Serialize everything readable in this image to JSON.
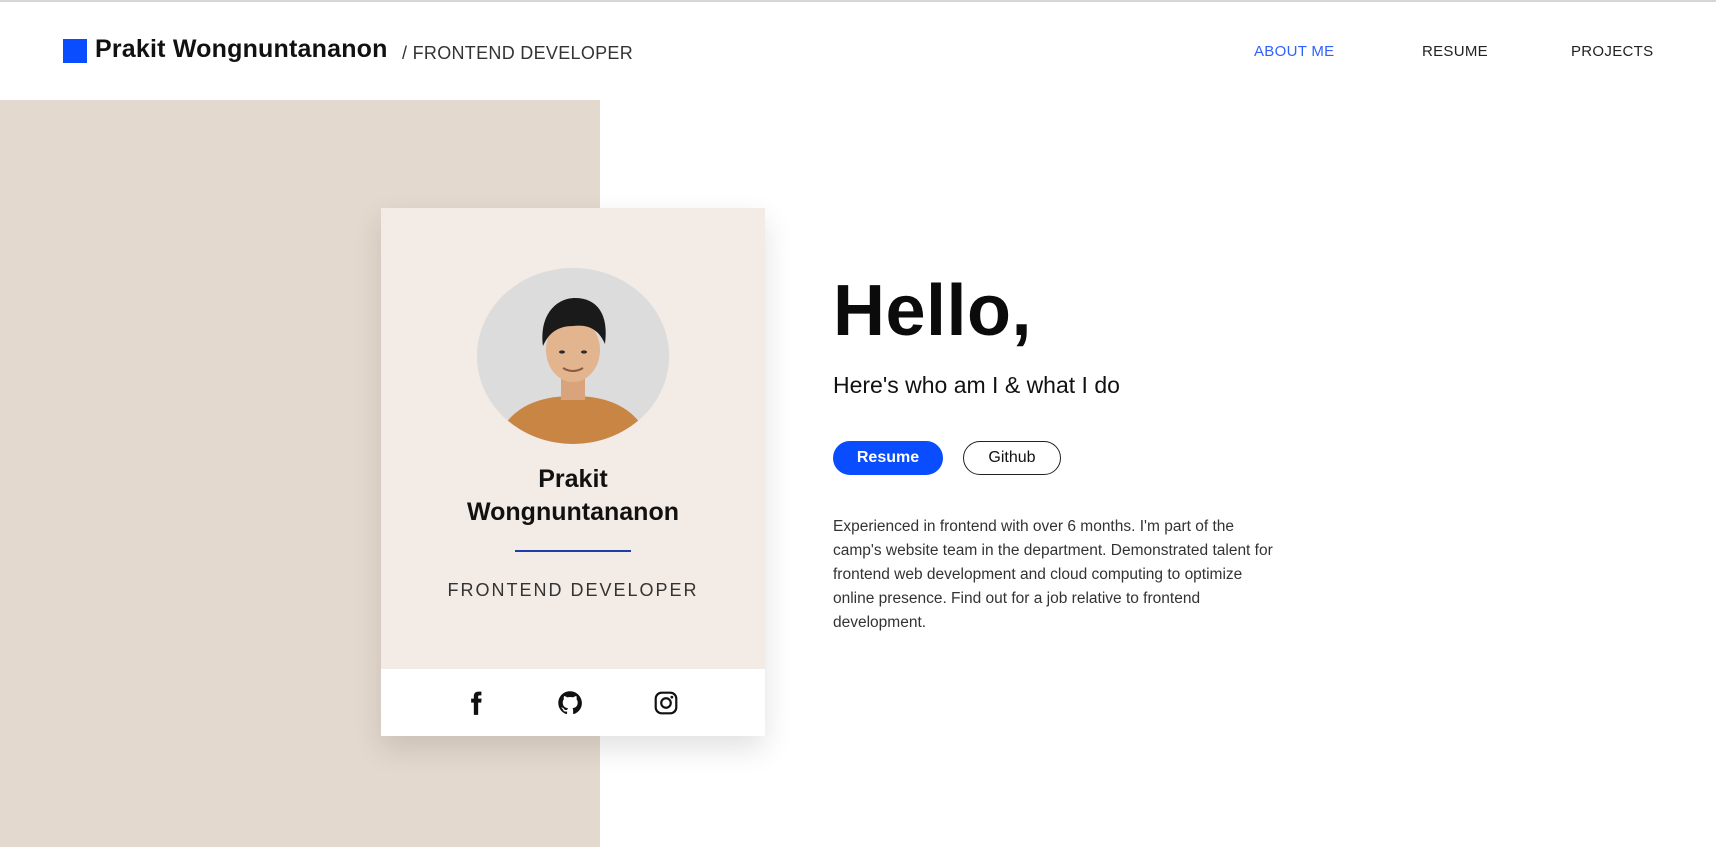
{
  "header": {
    "name": "Prakit Wongnuntananon",
    "role": "/ FRONTEND DEVELOPER",
    "nav": [
      {
        "label": "ABOUT ME",
        "active": true
      },
      {
        "label": "RESUME",
        "active": false
      },
      {
        "label": "PROJECTS",
        "active": false
      }
    ]
  },
  "card": {
    "name": "Prakit Wongnuntananon",
    "role": "FRONTEND DEVELOPER",
    "social": [
      "facebook-icon",
      "github-icon",
      "instagram-icon"
    ]
  },
  "hero": {
    "greeting": "Hello,",
    "subtitle": "Here's who am I & what I do",
    "buttons": {
      "resume": "Resume",
      "github": "Github"
    },
    "about": "Experienced in frontend with over 6 months. I'm part of the camp's website team in the department. Demonstrated talent for frontend web development and cloud computing to optimize online presence. Find out for a job relative to frontend development."
  },
  "colors": {
    "accent": "#0a4dff",
    "nav_active": "#2f62ff",
    "panel_beige": "#e4d9ce",
    "card_bg": "#f3ebe5"
  }
}
